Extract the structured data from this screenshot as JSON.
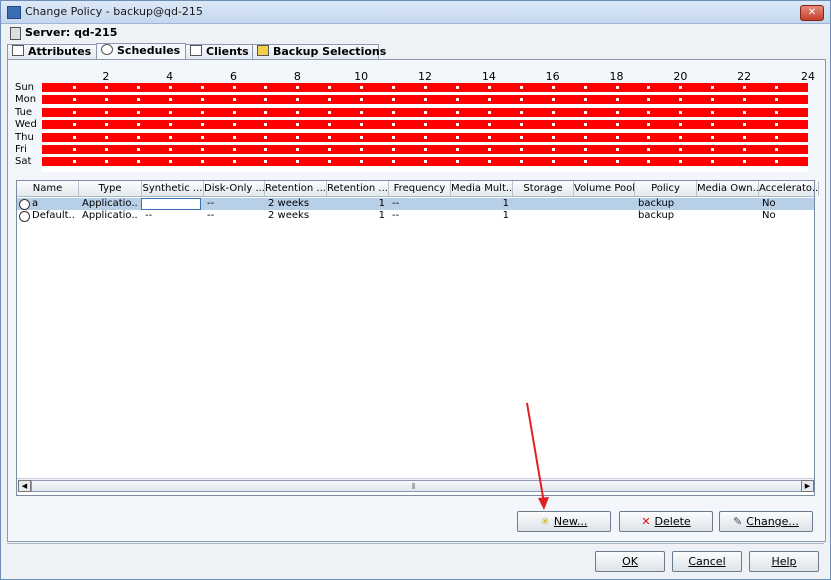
{
  "window": {
    "title": "Change Policy - backup@qd-215",
    "close_label": "✕"
  },
  "server": {
    "label": "Server: qd-215"
  },
  "tabs": [
    {
      "label": "Attributes"
    },
    {
      "label": "Schedules"
    },
    {
      "label": "Clients"
    },
    {
      "label": "Backup Selections"
    }
  ],
  "calendar": {
    "hours": [
      "2",
      "4",
      "6",
      "8",
      "10",
      "12",
      "14",
      "16",
      "18",
      "20",
      "22",
      "24"
    ],
    "days": [
      "Sun",
      "Mon",
      "Tue",
      "Wed",
      "Thu",
      "Fri",
      "Sat"
    ],
    "window_color": "#ff0000"
  },
  "table": {
    "columns": [
      "Name",
      "Type",
      "Synthetic ...",
      "Disk-Only ...",
      "Retention ...",
      "Retention ...",
      "Frequency",
      "Media Mult...",
      "Storage",
      "Volume Pool",
      "Policy",
      "Media Own...",
      "Accelerato..."
    ],
    "rows": [
      {
        "name": "a",
        "type": "Applicatio...",
        "synthetic": "--",
        "disk_only": "--",
        "retention": "2 weeks",
        "retention_level": "1",
        "frequency": "--",
        "media_mult": "1",
        "storage": "",
        "volume_pool": "",
        "policy": "backup",
        "media_owner": "",
        "accelerator": "No",
        "selected": true
      },
      {
        "name": "Default...",
        "type": "Applicatio...",
        "synthetic": "--",
        "disk_only": "--",
        "retention": "2 weeks",
        "retention_level": "1",
        "frequency": "--",
        "media_mult": "1",
        "storage": "",
        "volume_pool": "",
        "policy": "backup",
        "media_owner": "",
        "accelerator": "No",
        "selected": false
      }
    ]
  },
  "actions": {
    "new_label": "New...",
    "delete_label": "Delete",
    "change_label": "Change..."
  },
  "footer": {
    "ok_label": "OK",
    "cancel_label": "Cancel",
    "help_label": "Help"
  },
  "icons": {
    "new": "star-new-icon",
    "delete": "red-x-icon",
    "change": "edit-icon"
  }
}
